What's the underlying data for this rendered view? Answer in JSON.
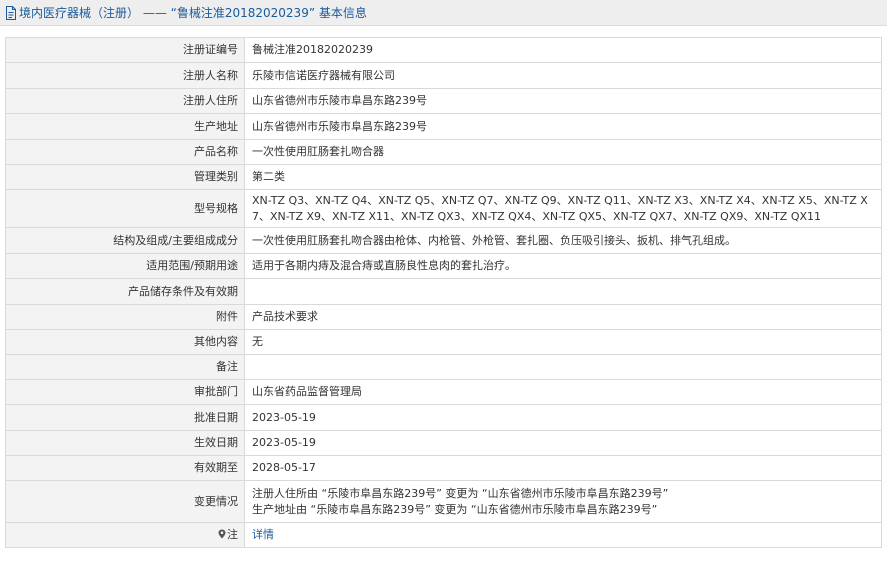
{
  "header": {
    "title": "境内医疗器械（注册） —— “鲁械注准20182020239” 基本信息"
  },
  "rows": [
    {
      "label": "注册证编号",
      "value": "鲁械注准20182020239"
    },
    {
      "label": "注册人名称",
      "value": "乐陵市信诺医疗器械有限公司"
    },
    {
      "label": "注册人住所",
      "value": "山东省德州市乐陵市阜昌东路239号"
    },
    {
      "label": "生产地址",
      "value": "山东省德州市乐陵市阜昌东路239号"
    },
    {
      "label": "产品名称",
      "value": "一次性使用肛肠套扎吻合器"
    },
    {
      "label": "管理类别",
      "value": "第二类"
    },
    {
      "label": "型号规格",
      "value": "XN-TZ Q3、XN-TZ Q4、XN-TZ Q5、XN-TZ Q7、XN-TZ Q9、XN-TZ Q11、XN-TZ X3、XN-TZ X4、XN-TZ X5、XN-TZ X7、XN-TZ X9、XN-TZ X11、XN-TZ QX3、XN-TZ QX4、XN-TZ QX5、XN-TZ QX7、XN-TZ QX9、XN-TZ QX11"
    },
    {
      "label": "结构及组成/主要组成成分",
      "value": "一次性使用肛肠套扎吻合器由枪体、内枪管、外枪管、套扎圈、负压吸引接头、扳机、排气孔组成。"
    },
    {
      "label": "适用范围/预期用途",
      "value": "适用于各期内痔及混合痔或直肠良性息肉的套扎治疗。"
    },
    {
      "label": "产品储存条件及有效期",
      "value": ""
    },
    {
      "label": "附件",
      "value": "产品技术要求"
    },
    {
      "label": "其他内容",
      "value": "无"
    },
    {
      "label": "备注",
      "value": ""
    },
    {
      "label": "审批部门",
      "value": "山东省药品监督管理局"
    },
    {
      "label": "批准日期",
      "value": "2023-05-19"
    },
    {
      "label": "生效日期",
      "value": "2023-05-19"
    },
    {
      "label": "有效期至",
      "value": "2028-05-17"
    }
  ],
  "change_row": {
    "label": "变更情况",
    "line1": "注册人住所由 “乐陵市阜昌东路239号” 变更为 “山东省德州市乐陵市阜昌东路239号”",
    "line2": "生产地址由 “乐陵市阜昌东路239号” 变更为 “山东省德州市乐陵市阜昌东路239号”"
  },
  "note_row": {
    "label": "注",
    "link_text": "详情",
    "icon": "pin-icon"
  },
  "colors": {
    "link": "#1a5a9c",
    "label_bg": "#f3f3f3",
    "border": "#d9d9d9",
    "header_bg": "#eeeeee"
  }
}
